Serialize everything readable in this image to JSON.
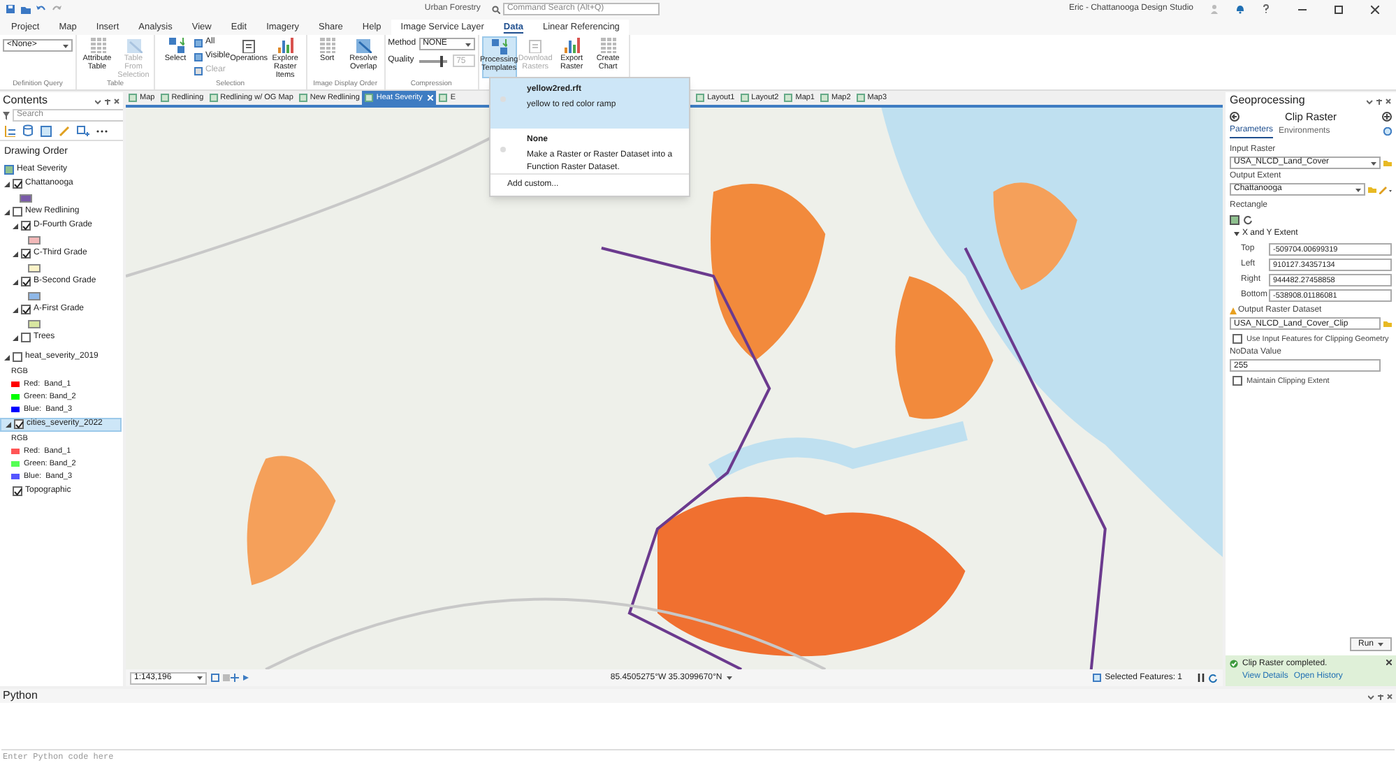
{
  "title_bar": {
    "project": "Urban Forestry",
    "search_placeholder": "Command Search (Alt+Q)",
    "user": "Eric - Chattanooga Design Studio"
  },
  "ribbon_tabs": [
    {
      "label": "Project",
      "selected": false,
      "contextual": false
    },
    {
      "label": "Map",
      "selected": false,
      "contextual": false
    },
    {
      "label": "Insert",
      "selected": false,
      "contextual": false
    },
    {
      "label": "Analysis",
      "selected": false,
      "contextual": false
    },
    {
      "label": "View",
      "selected": false,
      "contextual": false
    },
    {
      "label": "Edit",
      "selected": false,
      "contextual": false
    },
    {
      "label": "Imagery",
      "selected": false,
      "contextual": false
    },
    {
      "label": "Share",
      "selected": false,
      "contextual": false
    },
    {
      "label": "Help",
      "selected": false,
      "contextual": false
    },
    {
      "label": "Image Service Layer",
      "selected": false,
      "contextual": true
    },
    {
      "label": "Data",
      "selected": true,
      "contextual": true
    },
    {
      "label": "Linear Referencing",
      "selected": false,
      "contextual": true
    }
  ],
  "ribbon_groups": [
    {
      "label": "Definition Query",
      "items": [
        {
          "kind": "dropdown",
          "value": "<None>"
        }
      ]
    },
    {
      "label": "Table",
      "items": [
        {
          "kind": "large",
          "label": "Attribute Table",
          "disabled": false,
          "active": false
        },
        {
          "kind": "large",
          "label": "Table From Selection",
          "disabled": true,
          "active": false
        }
      ]
    },
    {
      "label": "Selection",
      "items": [
        {
          "kind": "large",
          "label": "Select",
          "disabled": false,
          "active": false
        },
        {
          "kind": "stack",
          "items": [
            {
              "label": "All",
              "disabled": false
            },
            {
              "label": "Visible",
              "disabled": false
            },
            {
              "label": "Clear",
              "disabled": true
            }
          ]
        },
        {
          "kind": "large",
          "label": "Operations",
          "disabled": false,
          "active": false
        },
        {
          "kind": "large",
          "label": "Explore Raster Items",
          "disabled": false,
          "active": false
        }
      ]
    },
    {
      "label": "Image Display Order",
      "items": [
        {
          "kind": "large",
          "label": "Sort",
          "disabled": false,
          "active": false
        },
        {
          "kind": "large",
          "label": "Resolve Overlap",
          "disabled": false,
          "active": false
        }
      ]
    },
    {
      "label": "Compression",
      "items": [
        {
          "kind": "fields",
          "method_label": "Method",
          "method": "NONE",
          "quality_label": "Quality",
          "level": 0.8,
          "quality": "75"
        }
      ]
    },
    {
      "items": [
        {
          "kind": "large",
          "label": "Processing Templates",
          "disabled": false,
          "active": true
        },
        {
          "kind": "large",
          "label": "Download Rasters",
          "disabled": true,
          "active": false
        },
        {
          "kind": "large",
          "label": "Export Raster",
          "disabled": false,
          "active": false
        },
        {
          "kind": "large",
          "label": "Create Chart",
          "disabled": false,
          "active": false
        }
      ]
    }
  ],
  "templates_menu": {
    "items": [
      {
        "title": "yellow2red.rft",
        "description": "yellow to red color ramp",
        "selected": true
      },
      {
        "title": "None",
        "description": "Make a Raster or Raster Dataset into a Function Raster Dataset.",
        "selected": false
      }
    ],
    "footer": "Add custom..."
  },
  "contents": {
    "title": "Contents",
    "search_placeholder": "Search",
    "heading": "Drawing Order",
    "layers": [
      {
        "kind": "map",
        "label": "Heat Severity"
      },
      {
        "kind": "layer",
        "label": "Chattanooga",
        "checked": true,
        "expanded": true,
        "selected": false,
        "color": "#7a5aa8"
      },
      {
        "kind": "layer",
        "label": "New Redlining",
        "checked": false,
        "expanded": true,
        "selected": false,
        "children": [
          {
            "kind": "layer",
            "label": "D-Fourth Grade",
            "checked": true,
            "expanded": true,
            "selected": false,
            "color": "#f2b8b8"
          },
          {
            "kind": "layer",
            "label": "C-Third Grade",
            "checked": true,
            "expanded": true,
            "selected": false,
            "color": "#fbf3c8"
          },
          {
            "kind": "layer",
            "label": "B-Second Grade",
            "checked": true,
            "expanded": true,
            "selected": false,
            "color": "#8fb8e8"
          },
          {
            "kind": "layer",
            "label": "A-First Grade",
            "checked": true,
            "expanded": true,
            "selected": false,
            "color": "#d8e6a0"
          },
          {
            "kind": "layer",
            "label": "Trees",
            "checked": false,
            "expanded": true,
            "selected": false
          }
        ]
      },
      {
        "kind": "layer",
        "label": "heat_severity_2019",
        "checked": false,
        "expanded": true,
        "selected": false,
        "legend": {
          "title": "RGB",
          "bands": [
            {
              "label": "Red:  Band_1",
              "color": "#ff0000"
            },
            {
              "label": "Green: Band_2",
              "color": "#00ff00"
            },
            {
              "label": "Blue:  Band_3",
              "color": "#0000ff"
            }
          ]
        }
      },
      {
        "kind": "layer",
        "label": "cities_severity_2022",
        "checked": true,
        "expanded": true,
        "selected": true,
        "legend": {
          "title": "RGB",
          "bands": [
            {
              "label": "Red:  Band_1",
              "color": "#ff5555"
            },
            {
              "label": "Green: Band_2",
              "color": "#55ff55"
            },
            {
              "label": "Blue:  Band_3",
              "color": "#5555ff"
            }
          ]
        }
      },
      {
        "kind": "layer",
        "label": "Topographic",
        "checked": true,
        "expanded": false,
        "selected": false
      }
    ]
  },
  "map_view_tabs": {
    "left": [
      {
        "label": "Map",
        "selected": false
      },
      {
        "label": "Redlining",
        "selected": false
      },
      {
        "label": "Redlining w/ OG Map",
        "selected": false
      },
      {
        "label": "New Redlining",
        "selected": false
      },
      {
        "label": "Heat Severity",
        "selected": true
      },
      {
        "label": "E",
        "selected": false
      }
    ],
    "right": [
      {
        "label": "Layout1",
        "selected": false
      },
      {
        "label": "Layout2",
        "selected": false
      },
      {
        "label": "Map1",
        "selected": false
      },
      {
        "label": "Map2",
        "selected": false
      },
      {
        "label": "Map3",
        "selected": false
      }
    ]
  },
  "status_bar": {
    "scale": "1:143,196",
    "coordinates": "85.4505275°W 35.3099670°N",
    "selected_features": "Selected Features: 1"
  },
  "geoprocessing": {
    "title": "Geoprocessing",
    "tool": "Clip Raster",
    "tabs": [
      {
        "label": "Parameters",
        "selected": true
      },
      {
        "label": "Environments",
        "selected": false
      }
    ],
    "params": [
      {
        "kind": "dropdown",
        "label": "Input Raster",
        "value": "USA_NLCD_Land_Cover"
      },
      {
        "kind": "dropdown",
        "label": "Output Extent",
        "value": "Chattanooga"
      },
      {
        "kind": "extent",
        "label": "Rectangle",
        "subheading": "X and Y Extent",
        "fields": [
          {
            "label": "Top",
            "value": "-509704.00699319"
          },
          {
            "label": "Left",
            "value": "910127.34357134"
          },
          {
            "label": "Right",
            "value": "944482.27458858"
          },
          {
            "label": "Bottom",
            "value": "-538908.01186081"
          }
        ]
      },
      {
        "kind": "text",
        "label": "Output Raster Dataset",
        "value": "USA_NLCD_Land_Cover_Clip",
        "warning": true
      },
      {
        "kind": "checkbox",
        "label": "Use Input Features for Clipping Geometry",
        "checked": false
      },
      {
        "kind": "text",
        "label": "NoData Value",
        "value": "255",
        "warning": false
      },
      {
        "kind": "checkbox",
        "label": "Maintain Clipping Extent",
        "checked": false
      }
    ],
    "run": "Run",
    "message": {
      "text": "Clip Raster completed.",
      "links": [
        "View Details",
        "Open History"
      ]
    }
  },
  "python": {
    "title": "Python",
    "placeholder": "Enter Python code here"
  }
}
